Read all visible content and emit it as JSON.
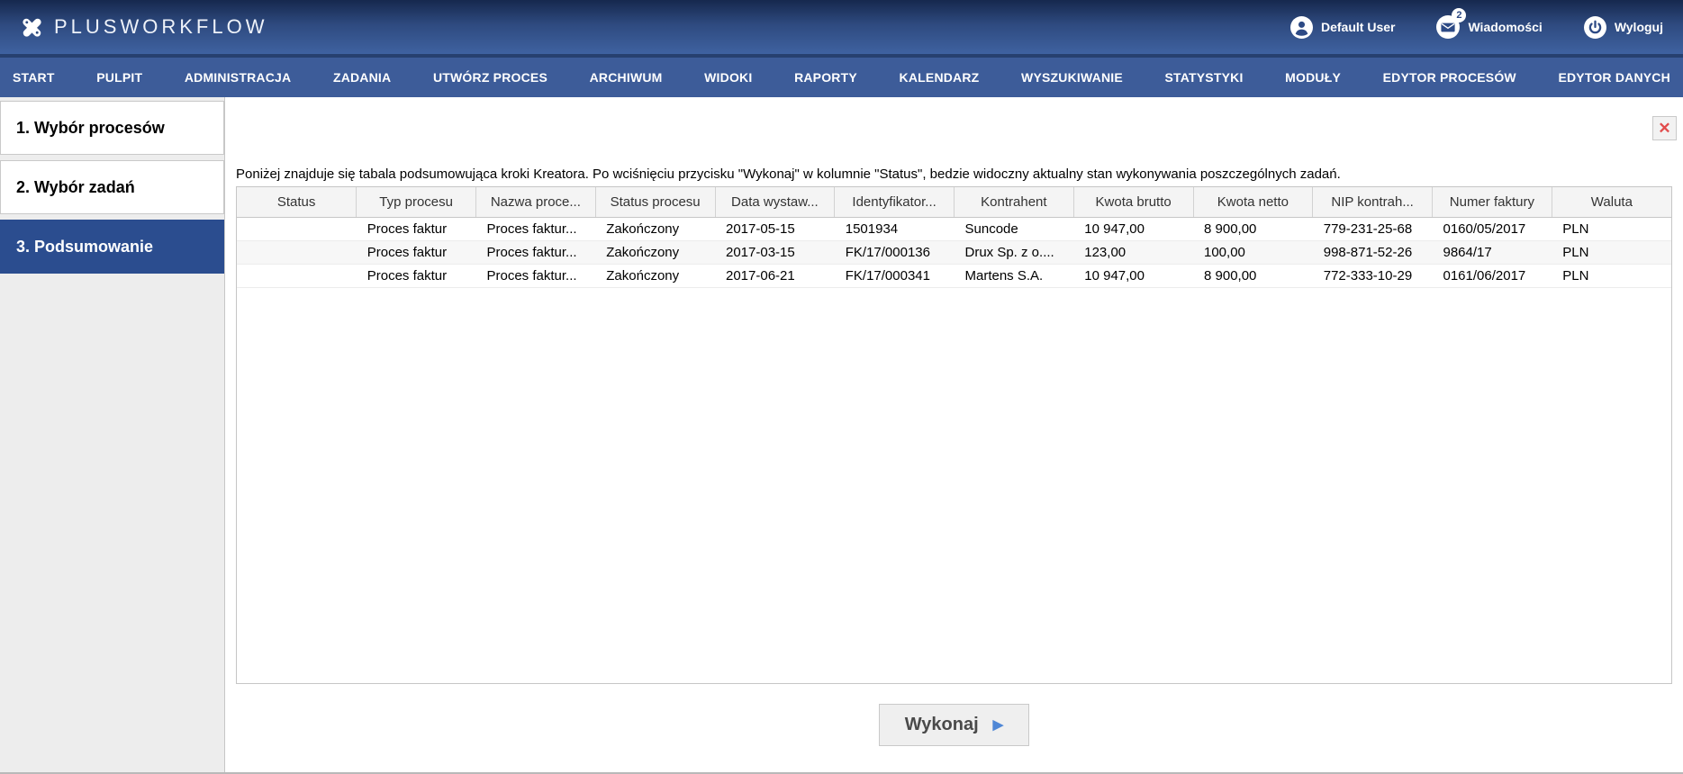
{
  "header": {
    "logo_text": "PLUSWORKFLOW",
    "user_label": "Default User",
    "messages_label": "Wiadomości",
    "messages_badge": "2",
    "logout_label": "Wyloguj"
  },
  "nav": {
    "items": [
      "START",
      "PULPIT",
      "ADMINISTRACJA",
      "ZADANIA",
      "UTWÓRZ PROCES",
      "ARCHIWUM",
      "WIDOKI",
      "RAPORTY",
      "KALENDARZ",
      "WYSZUKIWANIE",
      "STATYSTYKI",
      "MODUŁY",
      "EDYTOR PROCESÓW",
      "EDYTOR DANYCH"
    ]
  },
  "sidebar": {
    "steps": [
      {
        "label": "1. Wybór procesów",
        "active": false
      },
      {
        "label": "2. Wybór zadań",
        "active": false
      },
      {
        "label": "3. Podsumowanie",
        "active": true
      }
    ]
  },
  "main": {
    "description": "Poniżej znajduje się tabala podsumowująca kroki Kreatora. Po wciśnięciu przycisku \"Wykonaj\" w kolumnie \"Status\", bedzie widoczny aktualny stan wykonywania poszczególnych zadań.",
    "close_glyph": "✕",
    "table": {
      "columns": [
        "Status",
        "Typ procesu",
        "Nazwa proce...",
        "Status procesu",
        "Data wystaw...",
        "Identyfikator...",
        "Kontrahent",
        "Kwota brutto",
        "Kwota netto",
        "NIP kontrah...",
        "Numer faktury",
        "Waluta"
      ],
      "rows": [
        [
          "",
          "Proces faktur",
          "Proces faktur...",
          "Zakończony",
          "2017-05-15",
          "1501934",
          "Suncode",
          "10 947,00",
          "8 900,00",
          "779-231-25-68",
          "0160/05/2017",
          "PLN"
        ],
        [
          "",
          "Proces faktur",
          "Proces faktur...",
          "Zakończony",
          "2017-03-15",
          "FK/17/000136",
          "Drux Sp. z o....",
          "123,00",
          "100,00",
          "998-871-52-26",
          "9864/17",
          "PLN"
        ],
        [
          "",
          "Proces faktur",
          "Proces faktur...",
          "Zakończony",
          "2017-06-21",
          "FK/17/000341",
          "Martens S.A.",
          "10 947,00",
          "8 900,00",
          "772-333-10-29",
          "0161/06/2017",
          "PLN"
        ]
      ]
    },
    "execute_button": "Wykonaj",
    "execute_icon_glyph": "▶"
  },
  "colors": {
    "nav_blue": "#3d5c99",
    "header_top": "#16284e",
    "header_bottom": "#3f62a0",
    "active_step_blue": "#2b4d8f",
    "close_red": "#e24c4c",
    "play_blue": "#4f87d6"
  }
}
